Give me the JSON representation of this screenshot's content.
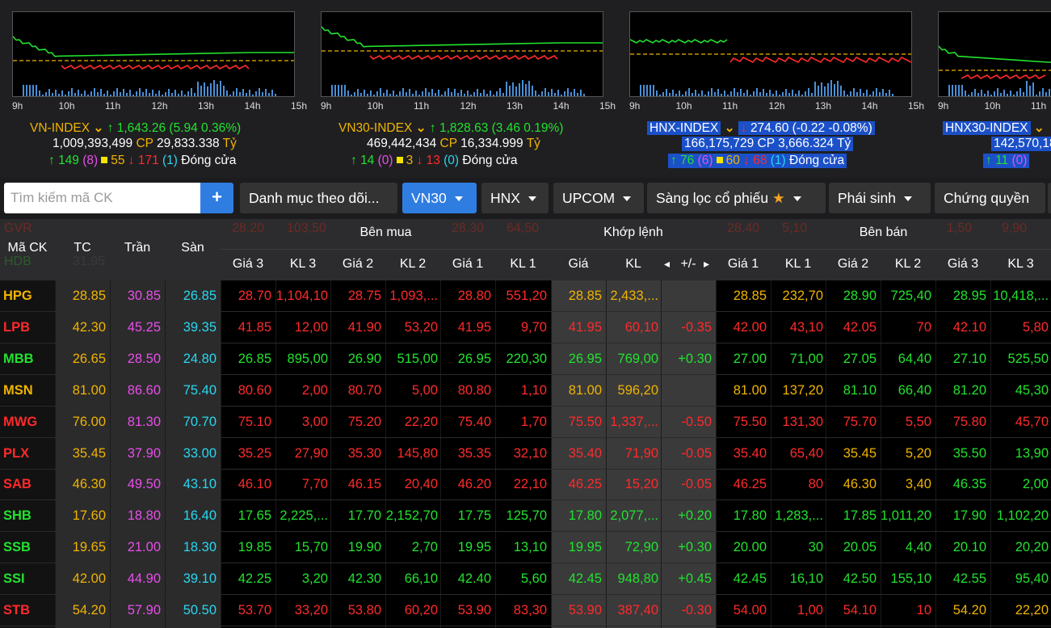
{
  "indices": [
    {
      "name": "VN-INDEX",
      "value": "1,643.26",
      "change": "(5.94 0.36%)",
      "direction": "up",
      "volume": "1,009,393,499",
      "cp_label": "CP",
      "value_text": "29,833.338",
      "unit": "Tỷ",
      "up": "149",
      "up_ceil": "(8)",
      "flat": "55",
      "down": "171",
      "down_floor": "(1)",
      "status": "Đóng cửa",
      "times": [
        "9h",
        "10h",
        "11h",
        "12h",
        "13h",
        "14h",
        "15h"
      ],
      "selected": false
    },
    {
      "name": "VN30-INDEX",
      "value": "1,828.63",
      "change": "(3.46 0.19%)",
      "direction": "up",
      "volume": "469,442,434",
      "cp_label": "CP",
      "value_text": "16,334.999",
      "unit": "Tỷ",
      "up": "14",
      "up_ceil": "(0)",
      "flat": "3",
      "down": "13",
      "down_floor": "(0)",
      "status": "Đóng cửa",
      "times": [
        "9h",
        "10h",
        "11h",
        "12h",
        "13h",
        "14h",
        "15h"
      ],
      "selected": false
    },
    {
      "name": "HNX-INDEX",
      "value": "274.60",
      "change": "(-0.22 -0.08%)",
      "direction": "down",
      "volume": "166,175,729",
      "cp_label": "CP",
      "value_text": "3,666.324",
      "unit": "Tỷ",
      "up": "76",
      "up_ceil": "(6)",
      "flat": "60",
      "down": "68",
      "down_floor": "(1)",
      "status": "Đóng cửa",
      "times": [
        "9h",
        "10h",
        "11h",
        "12h",
        "13h",
        "14h",
        "15h"
      ],
      "selected": true
    },
    {
      "name": "HNX30-INDEX",
      "value": "",
      "change": "",
      "direction": "up",
      "volume": "142,570,18",
      "cp_label": "",
      "value_text": "",
      "unit": "",
      "up": "11",
      "up_ceil": "(0)",
      "flat": "",
      "down": "",
      "down_floor": "",
      "status": "",
      "times": [
        "9h",
        "10h",
        "11h"
      ],
      "selected": true
    }
  ],
  "toolbar": {
    "search_placeholder": "Tìm kiếm mã CK",
    "add_label": "+",
    "tabs": [
      {
        "label": "Danh mục theo dõi...",
        "caret": false,
        "active": false
      },
      {
        "label": "VN30",
        "caret": true,
        "active": true
      },
      {
        "label": "HNX",
        "caret": true,
        "active": false
      },
      {
        "label": "UPCOM",
        "caret": true,
        "active": false
      },
      {
        "label": "Sàng lọc cổ phiếu",
        "caret": true,
        "star": true,
        "active": false
      },
      {
        "label": "Phái sinh",
        "caret": true,
        "active": false
      },
      {
        "label": "Chứng quyền",
        "caret": false,
        "active": false
      }
    ]
  },
  "table": {
    "groups": {
      "ma_ck": "Mã CK",
      "tc": "TC",
      "tran": "Trần",
      "san": "Sàn",
      "buy": "Bên mua",
      "match": "Khớp lệnh",
      "sell": "Bên bán"
    },
    "sub": [
      "Giá 3",
      "KL 3",
      "Giá 2",
      "KL 2",
      "Giá 1",
      "KL 1",
      "Giá",
      "KL",
      "+/-",
      "Giá 1",
      "KL 1",
      "Giá 2",
      "KL 2",
      "Giá 3",
      "KL 3"
    ],
    "ghost_rows": [
      {
        "sym": "GVR",
        "vals": [
          "28.20",
          "103,50",
          "",
          "",
          "28.30",
          "64,50",
          "",
          "",
          "",
          "28.40",
          "5,10",
          "",
          "",
          "1,50",
          "9,90"
        ]
      },
      {
        "sym": "HDB",
        "vals": [
          "31.95",
          "",
          "",
          "",
          "",
          "",
          "",
          "",
          "",
          "",
          "",
          "",
          "",
          "",
          ""
        ]
      }
    ],
    "rows": [
      {
        "sym": "HPG",
        "sc": "y",
        "tc": "28.85",
        "tran": "30.85",
        "san": "26.85",
        "b3": [
          "28.70",
          "r"
        ],
        "k3": [
          "1,104,10",
          "r"
        ],
        "b2": [
          "28.75",
          "r"
        ],
        "k2": [
          "1,093,...",
          "r"
        ],
        "b1": [
          "28.80",
          "r"
        ],
        "k1": [
          "551,20",
          "r"
        ],
        "p": [
          "28.85",
          "y"
        ],
        "kl": [
          "2,433,...",
          "y"
        ],
        "ch": [
          "",
          ""
        ],
        "s1": [
          "28.85",
          "y"
        ],
        "q1": [
          "232,70",
          "y"
        ],
        "s2": [
          "28.90",
          "g"
        ],
        "q2": [
          "725,40",
          "g"
        ],
        "s3": [
          "28.95",
          "g"
        ],
        "q3": [
          "10,418,...",
          "g"
        ]
      },
      {
        "sym": "LPB",
        "sc": "r",
        "tc": "42.30",
        "tran": "45.25",
        "san": "39.35",
        "b3": [
          "41.85",
          "r"
        ],
        "k3": [
          "12,00",
          "r"
        ],
        "b2": [
          "41.90",
          "r"
        ],
        "k2": [
          "53,20",
          "r"
        ],
        "b1": [
          "41.95",
          "r"
        ],
        "k1": [
          "9,70",
          "r"
        ],
        "p": [
          "41.95",
          "r"
        ],
        "kl": [
          "60,10",
          "r"
        ],
        "ch": [
          "-0.35",
          "r"
        ],
        "s1": [
          "42.00",
          "r"
        ],
        "q1": [
          "43,10",
          "r"
        ],
        "s2": [
          "42.05",
          "r"
        ],
        "q2": [
          "70",
          "r"
        ],
        "s3": [
          "42.10",
          "r"
        ],
        "q3": [
          "5,80",
          "r"
        ]
      },
      {
        "sym": "MBB",
        "sc": "g",
        "tc": "26.65",
        "tran": "28.50",
        "san": "24.80",
        "b3": [
          "26.85",
          "g"
        ],
        "k3": [
          "895,00",
          "g"
        ],
        "b2": [
          "26.90",
          "g"
        ],
        "k2": [
          "515,00",
          "g"
        ],
        "b1": [
          "26.95",
          "g"
        ],
        "k1": [
          "220,30",
          "g"
        ],
        "p": [
          "26.95",
          "g"
        ],
        "kl": [
          "769,00",
          "g"
        ],
        "ch": [
          "+0.30",
          "g"
        ],
        "s1": [
          "27.00",
          "g"
        ],
        "q1": [
          "71,00",
          "g"
        ],
        "s2": [
          "27.05",
          "g"
        ],
        "q2": [
          "64,40",
          "g"
        ],
        "s3": [
          "27.10",
          "g"
        ],
        "q3": [
          "525,50",
          "g"
        ]
      },
      {
        "sym": "MSN",
        "sc": "y",
        "tc": "81.00",
        "tran": "86.60",
        "san": "75.40",
        "b3": [
          "80.60",
          "r"
        ],
        "k3": [
          "2,00",
          "r"
        ],
        "b2": [
          "80.70",
          "r"
        ],
        "k2": [
          "5,00",
          "r"
        ],
        "b1": [
          "80.80",
          "r"
        ],
        "k1": [
          "1,10",
          "r"
        ],
        "p": [
          "81.00",
          "y"
        ],
        "kl": [
          "596,20",
          "y"
        ],
        "ch": [
          "",
          ""
        ],
        "s1": [
          "81.00",
          "y"
        ],
        "q1": [
          "137,20",
          "y"
        ],
        "s2": [
          "81.10",
          "g"
        ],
        "q2": [
          "66,40",
          "g"
        ],
        "s3": [
          "81.20",
          "g"
        ],
        "q3": [
          "45,30",
          "g"
        ]
      },
      {
        "sym": "MWG",
        "sc": "r",
        "tc": "76.00",
        "tran": "81.30",
        "san": "70.70",
        "b3": [
          "75.10",
          "r"
        ],
        "k3": [
          "3,00",
          "r"
        ],
        "b2": [
          "75.20",
          "r"
        ],
        "k2": [
          "22,20",
          "r"
        ],
        "b1": [
          "75.40",
          "r"
        ],
        "k1": [
          "1,70",
          "r"
        ],
        "p": [
          "75.50",
          "r"
        ],
        "kl": [
          "1,337,...",
          "r"
        ],
        "ch": [
          "-0.50",
          "r"
        ],
        "s1": [
          "75.50",
          "r"
        ],
        "q1": [
          "131,30",
          "r"
        ],
        "s2": [
          "75.70",
          "r"
        ],
        "q2": [
          "5,50",
          "r"
        ],
        "s3": [
          "75.80",
          "r"
        ],
        "q3": [
          "45,70",
          "r"
        ]
      },
      {
        "sym": "PLX",
        "sc": "r",
        "tc": "35.45",
        "tran": "37.90",
        "san": "33.00",
        "b3": [
          "35.25",
          "r"
        ],
        "k3": [
          "27,90",
          "r"
        ],
        "b2": [
          "35.30",
          "r"
        ],
        "k2": [
          "145,80",
          "r"
        ],
        "b1": [
          "35.35",
          "r"
        ],
        "k1": [
          "32,10",
          "r"
        ],
        "p": [
          "35.40",
          "r"
        ],
        "kl": [
          "71,90",
          "r"
        ],
        "ch": [
          "-0.05",
          "r"
        ],
        "s1": [
          "35.40",
          "r"
        ],
        "q1": [
          "65,40",
          "r"
        ],
        "s2": [
          "35.45",
          "y"
        ],
        "q2": [
          "5,20",
          "y"
        ],
        "s3": [
          "35.50",
          "g"
        ],
        "q3": [
          "13,90",
          "g"
        ]
      },
      {
        "sym": "SAB",
        "sc": "r",
        "tc": "46.30",
        "tran": "49.50",
        "san": "43.10",
        "b3": [
          "46.10",
          "r"
        ],
        "k3": [
          "7,70",
          "r"
        ],
        "b2": [
          "46.15",
          "r"
        ],
        "k2": [
          "20,40",
          "r"
        ],
        "b1": [
          "46.20",
          "r"
        ],
        "k1": [
          "22,10",
          "r"
        ],
        "p": [
          "46.25",
          "r"
        ],
        "kl": [
          "15,20",
          "r"
        ],
        "ch": [
          "-0.05",
          "r"
        ],
        "s1": [
          "46.25",
          "r"
        ],
        "q1": [
          "80",
          "r"
        ],
        "s2": [
          "46.30",
          "y"
        ],
        "q2": [
          "3,40",
          "y"
        ],
        "s3": [
          "46.35",
          "g"
        ],
        "q3": [
          "2,00",
          "g"
        ]
      },
      {
        "sym": "SHB",
        "sc": "g",
        "tc": "17.60",
        "tran": "18.80",
        "san": "16.40",
        "b3": [
          "17.65",
          "g"
        ],
        "k3": [
          "2,225,...",
          "g"
        ],
        "b2": [
          "17.70",
          "g"
        ],
        "k2": [
          "2,152,70",
          "g"
        ],
        "b1": [
          "17.75",
          "g"
        ],
        "k1": [
          "125,70",
          "g"
        ],
        "p": [
          "17.80",
          "g"
        ],
        "kl": [
          "2,077,...",
          "g"
        ],
        "ch": [
          "+0.20",
          "g"
        ],
        "s1": [
          "17.80",
          "g"
        ],
        "q1": [
          "1,283,...",
          "g"
        ],
        "s2": [
          "17.85",
          "g"
        ],
        "q2": [
          "1,011,20",
          "g"
        ],
        "s3": [
          "17.90",
          "g"
        ],
        "q3": [
          "1,102,20",
          "g"
        ]
      },
      {
        "sym": "SSB",
        "sc": "g",
        "tc": "19.65",
        "tran": "21.00",
        "san": "18.30",
        "b3": [
          "19.85",
          "g"
        ],
        "k3": [
          "15,70",
          "g"
        ],
        "b2": [
          "19.90",
          "g"
        ],
        "k2": [
          "2,70",
          "g"
        ],
        "b1": [
          "19.95",
          "g"
        ],
        "k1": [
          "13,10",
          "g"
        ],
        "p": [
          "19.95",
          "g"
        ],
        "kl": [
          "72,90",
          "g"
        ],
        "ch": [
          "+0.30",
          "g"
        ],
        "s1": [
          "20.00",
          "g"
        ],
        "q1": [
          "30",
          "g"
        ],
        "s2": [
          "20.05",
          "g"
        ],
        "q2": [
          "4,40",
          "g"
        ],
        "s3": [
          "20.10",
          "g"
        ],
        "q3": [
          "20,20",
          "g"
        ]
      },
      {
        "sym": "SSI",
        "sc": "g",
        "tc": "42.00",
        "tran": "44.90",
        "san": "39.10",
        "b3": [
          "42.25",
          "g"
        ],
        "k3": [
          "3,20",
          "g"
        ],
        "b2": [
          "42.30",
          "g"
        ],
        "k2": [
          "66,10",
          "g"
        ],
        "b1": [
          "42.40",
          "g"
        ],
        "k1": [
          "5,60",
          "g"
        ],
        "p": [
          "42.45",
          "g"
        ],
        "kl": [
          "948,80",
          "g"
        ],
        "ch": [
          "+0.45",
          "g"
        ],
        "s1": [
          "42.45",
          "g"
        ],
        "q1": [
          "16,10",
          "g"
        ],
        "s2": [
          "42.50",
          "g"
        ],
        "q2": [
          "155,10",
          "g"
        ],
        "s3": [
          "42.55",
          "g"
        ],
        "q3": [
          "95,40",
          "g"
        ]
      },
      {
        "sym": "STB",
        "sc": "r",
        "tc": "54.20",
        "tran": "57.90",
        "san": "50.50",
        "b3": [
          "53.70",
          "r"
        ],
        "k3": [
          "33,20",
          "r"
        ],
        "b2": [
          "53.80",
          "r"
        ],
        "k2": [
          "60,20",
          "r"
        ],
        "b1": [
          "53.90",
          "r"
        ],
        "k1": [
          "83,30",
          "r"
        ],
        "p": [
          "53.90",
          "r"
        ],
        "kl": [
          "387,40",
          "r"
        ],
        "ch": [
          "-0.30",
          "r"
        ],
        "s1": [
          "54.00",
          "r"
        ],
        "q1": [
          "1,00",
          "r"
        ],
        "s2": [
          "54.10",
          "r"
        ],
        "q2": [
          "10",
          "r"
        ],
        "s3": [
          "54.20",
          "y"
        ],
        "q3": [
          "22,20",
          "y"
        ]
      }
    ]
  },
  "colors": {
    "up": "#22e22e",
    "down": "#ff2a2a",
    "ref": "#f0b400",
    "ceil": "#e84fe8",
    "floor": "#28d7ef",
    "active": "#2f7de1"
  }
}
